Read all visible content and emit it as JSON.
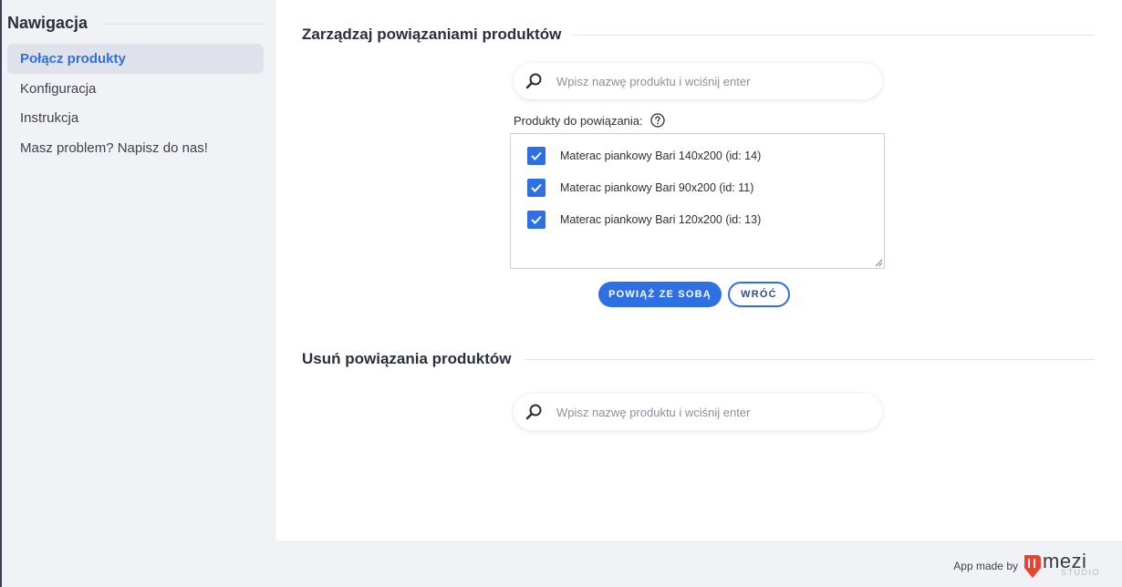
{
  "sidebar": {
    "title": "Nawigacja",
    "items": [
      {
        "label": "Połącz produkty",
        "active": true
      },
      {
        "label": "Konfiguracja",
        "active": false
      },
      {
        "label": "Instrukcja",
        "active": false
      },
      {
        "label": "Masz problem? Napisz do nas!",
        "active": false
      }
    ]
  },
  "manage": {
    "title": "Zarządzaj powiązaniami produktów",
    "search_placeholder": "Wpisz nazwę produktu i wciśnij enter",
    "products_label": "Produkty do powiązania:",
    "products": [
      {
        "label": "Materac piankowy Bari 140x200 (id: 14)",
        "checked": true
      },
      {
        "label": "Materac piankowy Bari 90x200 (id: 11)",
        "checked": true
      },
      {
        "label": "Materac piankowy Bari 120x200 (id: 13)",
        "checked": true
      }
    ],
    "link_button": "POWIĄŻ ZE SOBĄ",
    "back_button": "WRÓĆ"
  },
  "remove": {
    "title": "Usuń powiązania produktów",
    "search_placeholder": "Wpisz nazwę produktu i wciśnij enter"
  },
  "footer": {
    "credit": "App made by",
    "brand_name": "mezi",
    "brand_sub": "STUDIO"
  },
  "icons": {
    "search": "search-icon",
    "help": "question-circle-icon",
    "check": "check-icon",
    "logo": "amezi-logo-icon"
  },
  "colors": {
    "accent": "#2f6fe4",
    "sidebar_active_bg": "#e0e2eb",
    "page_bg": "#f1f2f5",
    "logo_red": "#e8442f"
  }
}
